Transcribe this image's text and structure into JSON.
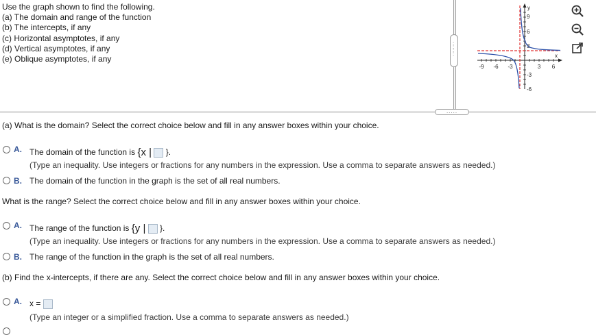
{
  "instructions": {
    "intro": "Use the graph shown to find the following.",
    "items": [
      "(a) The domain and range of the function",
      "(b) The intercepts, if any",
      "(c) Horizontal asymptotes, if any",
      "(d) Vertical asymptotes, if any",
      "(e) Oblique asymptotes, if any"
    ]
  },
  "graph": {
    "x_label": "x",
    "y_label": "y",
    "x_ticks": [
      "-9",
      "-6",
      "-3",
      "3",
      "6"
    ],
    "y_ticks_pos": [
      "9",
      "6",
      "3"
    ],
    "y_ticks_neg": [
      "-3",
      "-6"
    ],
    "asymptote_color": "#e03030",
    "curve_color": "#2b4fa8"
  },
  "tools": {
    "zoom_in": "zoom-in-icon",
    "zoom_out": "zoom-out-icon",
    "popout": "popout-icon"
  },
  "splitter": {
    "handle_dots": "....."
  },
  "part_a": {
    "domain_question": "(a) What is the domain? Select the correct choice below and fill in any answer boxes within your choice.",
    "domain_choice_a": {
      "letter": "A.",
      "text_before": "The domain of the function is",
      "set_open": "{x |",
      "set_close": "}.",
      "hint": "(Type an inequality. Use integers or fractions for any numbers in the expression. Use a comma to separate answers as needed.)"
    },
    "domain_choice_b": {
      "letter": "B.",
      "text": "The domain of the function in the graph is the set of all real numbers."
    },
    "range_question": "What is the range? Select the correct choice below and fill in any answer boxes within your choice.",
    "range_choice_a": {
      "letter": "A.",
      "text_before": "The range of the function is",
      "set_open": "{y |",
      "set_close": "}.",
      "hint": "(Type an inequality. Use integers or fractions for any numbers in the expression. Use a comma to separate answers as needed.)"
    },
    "range_choice_b": {
      "letter": "B.",
      "text": "The range of the function in the graph is the set of all real numbers."
    }
  },
  "part_b": {
    "question": "(b) Find the x-intercepts, if there are any. Select the correct choice below and fill in any answer boxes within your choice.",
    "choice_a": {
      "letter": "A.",
      "prefix": "x =",
      "hint": "(Type an integer or a simplified fraction. Use a comma to separate answers as needed.)"
    }
  }
}
